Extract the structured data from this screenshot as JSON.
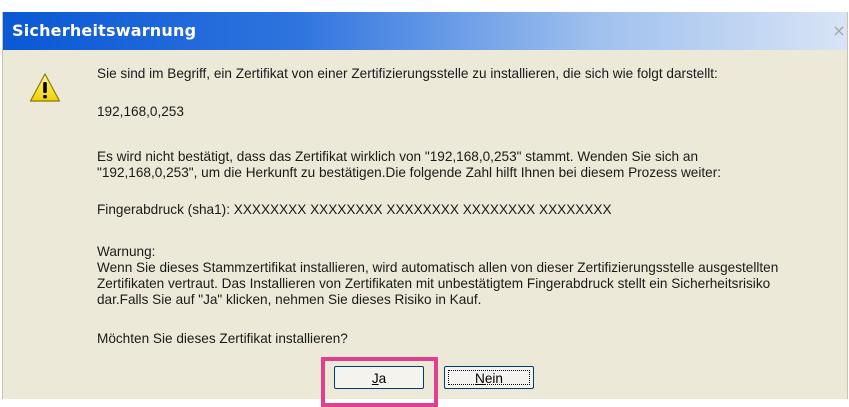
{
  "window": {
    "title": "Sicherheitswarnung",
    "close_glyph": "×"
  },
  "icon": {
    "name": "warning-icon",
    "color": "#f5d800"
  },
  "text": {
    "intro": "Sie sind im Begriff, ein Zertifikat von einer Zertifizierungsstelle zu installieren, die sich wie folgt darstellt:",
    "host": "192,168,0,253",
    "notice": "Es wird nicht bestätigt, dass das Zertifikat wirklich von \"192,168,0,253\" stammt. Wenden Sie sich an\n\"192,168,0,253\", um die Herkunft zu bestätigen.Die folgende Zahl hilft Ihnen bei diesem Prozess weiter:",
    "fingerprint": "Fingerabdruck (sha1): XXXXXXXX XXXXXXXX XXXXXXXX XXXXXXXX XXXXXXXX",
    "warning": "Warnung:\nWenn Sie dieses Stammzertifikat installieren, wird automatisch allen von dieser Zertifizierungsstelle ausgestellten\nZertifikaten vertraut. Das Installieren von Zertifikaten mit unbestätigtem Fingerabdruck stellt ein Sicherheitsrisiko\ndar.Falls Sie auf \"Ja\" klicken, nehmen Sie dieses Risiko in Kauf.",
    "question": "Möchten Sie dieses Zertifikat installieren?"
  },
  "buttons": {
    "yes_mnemonic": "J",
    "yes_rest": "a",
    "no_mnemonic": "N",
    "no_rest": "ein"
  },
  "highlight_color": "#e0408f"
}
